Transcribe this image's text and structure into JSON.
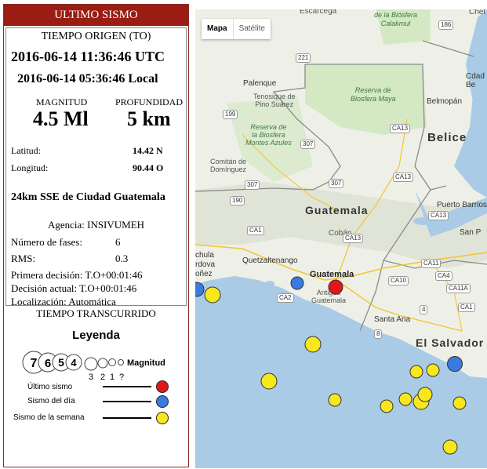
{
  "panel": {
    "title": "ULTIMO SISMO",
    "origin_time_label": "TIEMPO ORIGEN (TO)",
    "utc_time": "2016-06-14 11:36:46 UTC",
    "local_time": "2016-06-14 05:36:46 Local",
    "magnitude_label": "MAGNITUD",
    "depth_label": "PROFUNDIDAD",
    "magnitude_value": "4.5 Ml",
    "depth_value": "5 km",
    "lat_label": "Latitud:",
    "lat_value": "14.42 N",
    "lon_label": "Longitud:",
    "lon_value": "90.44 O",
    "location": "24km SSE de Ciudad Guatemala",
    "agency": "Agencia: INSIVUMEH",
    "phases_label": "Número de fases:",
    "phases_value": "6",
    "rms_label": "RMS:",
    "rms_value": "0.3",
    "first_decision": "Primera decisión: T.O+00:01:46",
    "current_decision": "Decisión actual: T.O+00:01:46",
    "localization": "Localización: Automática",
    "elapsed_label": "TIEMPO TRANSCURRIDO"
  },
  "legend": {
    "title": "Leyenda",
    "magnitude_text": "Magnitud",
    "big_digits": [
      "7",
      "6",
      "5",
      "4"
    ],
    "small_digits": [
      "3",
      "2",
      "1",
      "?"
    ],
    "items": [
      {
        "label": "Último sismo",
        "color": "#e0161b"
      },
      {
        "label": "Sismo del día",
        "color": "#3a7be0"
      },
      {
        "label": "Sismo de la semana",
        "color": "#f8e71c"
      }
    ]
  },
  "map": {
    "type_map": "Mapa",
    "type_satellite": "Satélite",
    "labels": {
      "escarcega": "Escárcega",
      "biosfera_calakmul": "de la Biósfera\nCalakmul",
      "chetumal": "Chet",
      "palenque": "Palenque",
      "tenosique": "Tenosique de\nPino Suárez",
      "reserva_maya": "Reserva de\nBiosfera Maya",
      "belmopan": "Belmopán",
      "cdad_be": "Cdad\nBe",
      "reserva_montes": "Reserva de\nla Biosfera\nMontes Azules",
      "comitan": "Comitán de\nDomínguez",
      "belice": "Belice",
      "guatemala_country": "Guatemala",
      "puerto_barrios": "Puerto Barrios",
      "coban": "Cobán",
      "san_p": "San P",
      "chula": "chula",
      "rdova": "rdova",
      "onez": "oñez",
      "quetzaltenango": "Quetzaltenango",
      "guatemala_city": "Guatemala",
      "antigua": "Antigua\nGuatemala",
      "santa_ana": "Santa Ana",
      "el_salvador": "El Salvador"
    },
    "roads": [
      "186",
      "221",
      "199",
      "307",
      "307",
      "CA13",
      "CA13",
      "190",
      "307",
      "CA13",
      "CA1",
      "CA2",
      "CA10",
      "CA11",
      "CA4",
      "CA11A",
      "CA1",
      "4",
      "8",
      "CA13"
    ],
    "quakes": {
      "latest": "#e0161b",
      "day": "#3a7be0",
      "week": "#f8e71c"
    }
  }
}
